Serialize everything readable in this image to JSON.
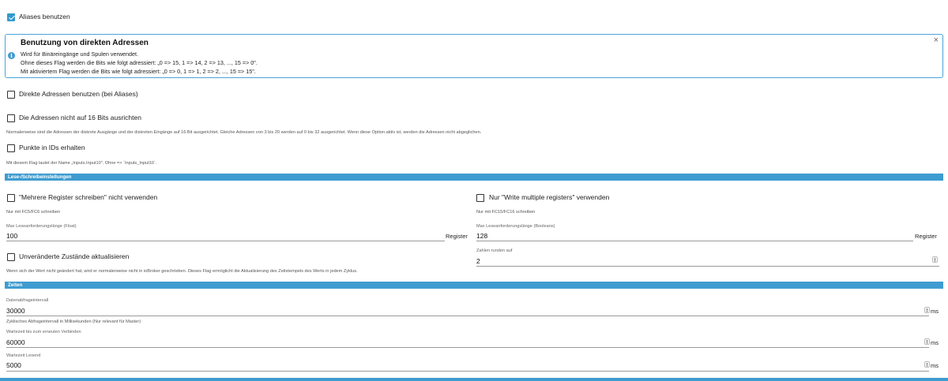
{
  "aliases": {
    "label": "Aliases benutzen",
    "checked": true
  },
  "info_box": {
    "title": "Benutzung von direkten Adressen",
    "lines": [
      "Wird für Binäreingänge und Spulen verwendet.",
      "Ohne dieses Flag werden die Bits wie folgt adressiert: „0 => 15, 1 => 14, 2 => 13, ..., 15 => 0\".",
      "Mit aktiviertem Flag werden die Bits wie folgt adressiert: „0 => 0, 1 => 1, 2 => 2, ..., 15 => 15\"."
    ],
    "info_glyph": "i",
    "close_glyph": "×"
  },
  "direct_addresses": {
    "label": "Direkte Adressen benutzen (bei Aliases)",
    "checked": false
  },
  "no_align": {
    "label": "Die Adressen nicht auf 16 Bits ausrichten",
    "checked": false,
    "help": "Normalerweise sind die Adressen der diskrete Ausgänge und der diskreten Eingänge auf 16 Bit ausgerichtet. Gleiche Adressen von 3 bis 20 werden auf 0 bis 32 ausgerichtet. Wenn diese Option aktiv ist, werden die Adressen nicht abgeglichen."
  },
  "keep_dots": {
    "label": "Punkte in IDs erhalten",
    "checked": false,
    "help": "Mit diesem Flag lautet der Name „Inputs.Input10\". Ohne => `Inputs_Input10`."
  },
  "section_rw": {
    "title": "Lese-/Schreibeinstellungen"
  },
  "multi_register": {
    "label": "\"Mehrere Register schreiben\" nicht verwenden",
    "checked": false,
    "help": "Nur mit FC5/FC6 schreiben"
  },
  "write_multiple": {
    "label": "Nur \"Write multiple registers\" verwenden",
    "checked": false,
    "help": "Nur mit FC15/FC16 schreiben"
  },
  "max_float": {
    "caption": "Max Leseanforderungslänge (Float)",
    "value": "100",
    "unit": "Register"
  },
  "max_bool": {
    "caption": "Max Leseanforderungslänge (Booleans)",
    "value": "128",
    "unit": "Register"
  },
  "update_unchanged": {
    "label": "Unveränderte Zustände aktualisieren",
    "checked": false,
    "help": "Wenn sich der Wert nicht geändert hat, wird er normalerweise nicht in ioBroker geschrieben. Dieses Flag ermöglicht die Aktualisierung des Zeitstempels des Werts in jedem Zyklus."
  },
  "round": {
    "caption": "Zahlen runden auf",
    "value": "2"
  },
  "section_times": {
    "title": "Zeiten"
  },
  "poll_interval": {
    "caption": "Datenabfrageintervall",
    "value": "30000",
    "unit": "ms",
    "help": "Zyklisches Abfrageintervall in Millisekunden (Nur relevant für Master)"
  },
  "reconnect": {
    "caption": "Wartezeit bis zum erneuten Verbinden",
    "value": "60000",
    "unit": "ms"
  },
  "read_wait": {
    "caption": "Wartezeit Lesend",
    "value": "5000",
    "unit": "ms"
  },
  "spinner_glyphs": {
    "up": "▲",
    "down": "▼"
  },
  "colors": {
    "accent": "#3f9cd0",
    "checkbox": "#3399cc"
  }
}
